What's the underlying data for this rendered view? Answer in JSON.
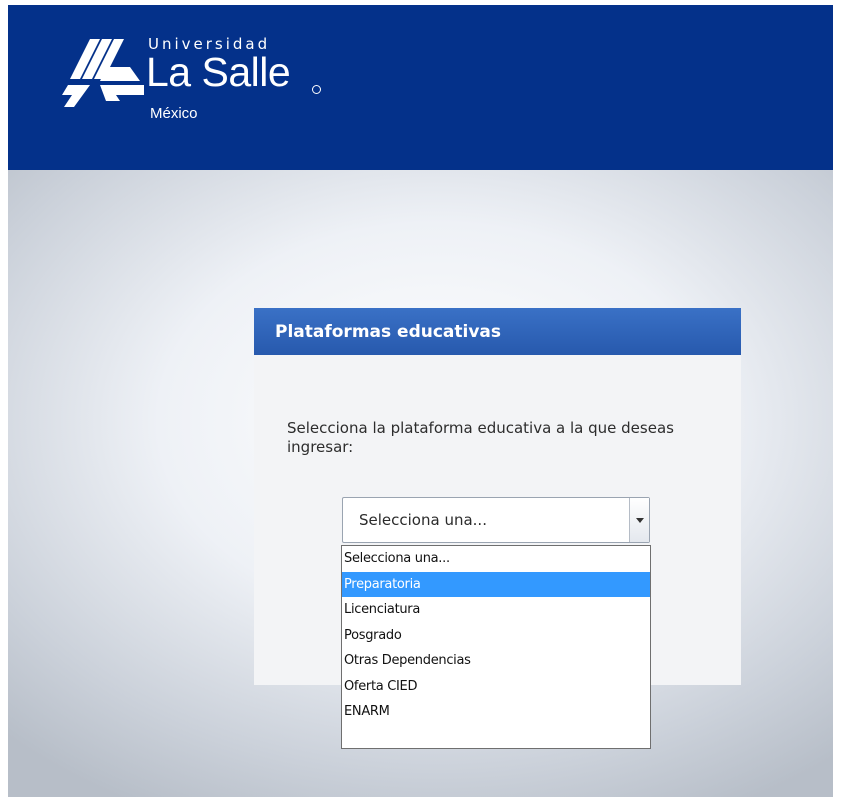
{
  "header": {
    "logo": {
      "university": "Universidad",
      "name": "La Salle",
      "country": "México"
    },
    "background_color": "#04318a"
  },
  "panel": {
    "title": "Plataformas educativas",
    "instruction": "Selecciona la plataforma educativa a la que deseas ingresar:",
    "header_color": "#2f63b8"
  },
  "select": {
    "value": "Selecciona una...",
    "arrow_icon": "caret-down-icon",
    "options": [
      {
        "label": "Selecciona una..."
      },
      {
        "label": "Preparatoria",
        "highlighted": true
      },
      {
        "label": "Licenciatura"
      },
      {
        "label": "Posgrado"
      },
      {
        "label": "Otras Dependencias"
      },
      {
        "label": "Oferta CIED"
      },
      {
        "label": "ENARM"
      }
    ],
    "highlight_color": "#3399ff"
  }
}
